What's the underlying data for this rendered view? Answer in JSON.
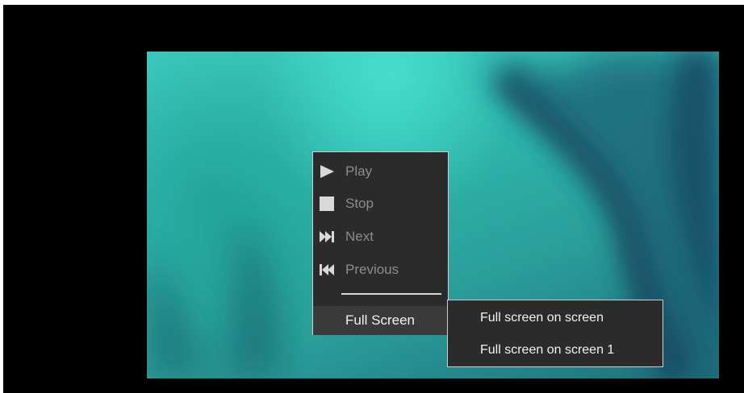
{
  "video": {
    "description_icon": "blurred-underwater-frame"
  },
  "context_menu": {
    "items": [
      {
        "label": "Play",
        "icon": "play-icon",
        "enabled": false
      },
      {
        "label": "Stop",
        "icon": "stop-icon",
        "enabled": false
      },
      {
        "label": "Next",
        "icon": "next-icon",
        "enabled": false
      },
      {
        "label": "Previous",
        "icon": "previous-icon",
        "enabled": false
      }
    ],
    "fullscreen": {
      "label": "Full Screen",
      "highlighted": true
    }
  },
  "submenu": {
    "items": [
      {
        "label": "Full screen on screen"
      },
      {
        "label": "Full screen on screen 1"
      }
    ]
  },
  "colors": {
    "menu_bg": "#2b2b2b",
    "menu_border": "#cfcfcf",
    "disabled_text": "#8c8c8c",
    "active_text": "#f2f2f2",
    "icon_color": "#d9d9d9"
  }
}
